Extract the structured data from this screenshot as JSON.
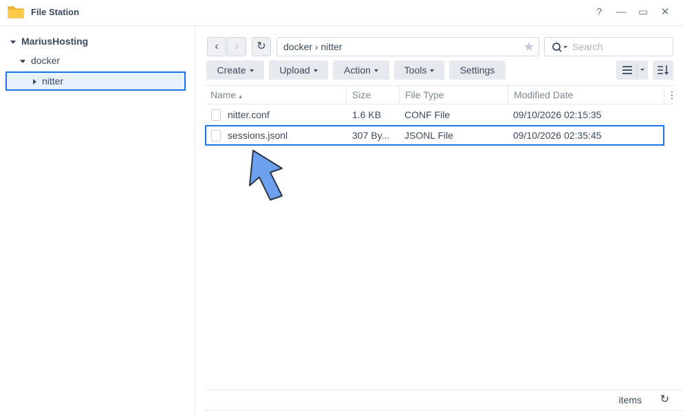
{
  "window": {
    "title": "File Station",
    "help_glyph": "?",
    "minimize_glyph": "—",
    "maximize_glyph": "▭",
    "close_glyph": "✕",
    "icon": "folder-icon"
  },
  "tree": {
    "root": "MariusHosting",
    "folder": "docker",
    "selected": "nitter"
  },
  "toolbar": {
    "back_glyph": "‹",
    "forward_glyph": "›",
    "refresh_glyph": "↻",
    "path": "docker › nitter",
    "search_placeholder": "Search",
    "create_label": "Create",
    "upload_label": "Upload",
    "action_label": "Action",
    "tools_label": "Tools",
    "settings_label": "Settings"
  },
  "table": {
    "columns": [
      "Name",
      "Size",
      "File Type",
      "Modified Date"
    ],
    "sort_indicator": "▴",
    "more_glyph": "⋮",
    "rows": [
      {
        "name": "nitter.conf",
        "size": "1.6 KB",
        "type": "CONF File",
        "modified": "09/10/2026 02:15:35"
      },
      {
        "name": "sessions.jsonl",
        "size": "307 By...",
        "type": "JSONL File",
        "modified": "09/10/2026 02:35:45"
      }
    ]
  },
  "footer": {
    "items_label": "items",
    "refresh_glyph": "↻"
  },
  "colors": {
    "accent": "#1a73e8",
    "arrow_fill": "#6ea0f0",
    "folder_yellow": "#f5b82e"
  }
}
